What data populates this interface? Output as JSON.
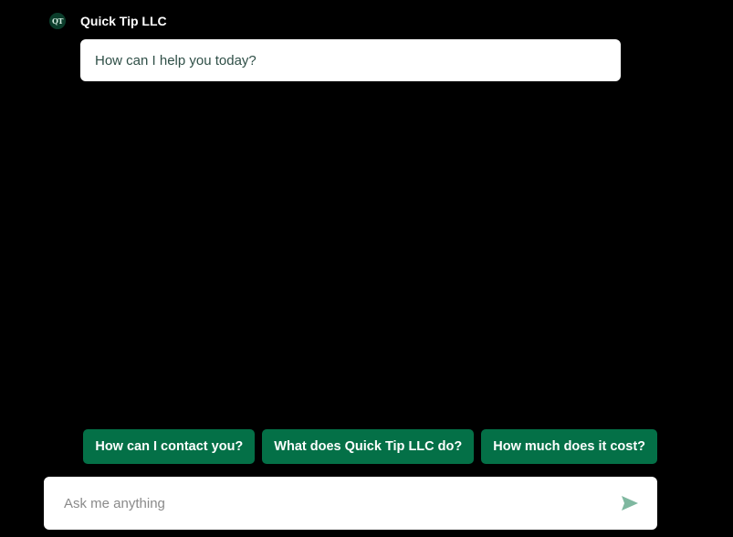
{
  "header": {
    "avatar_text": "QT",
    "bot_name": "Quick Tip LLC"
  },
  "messages": [
    {
      "from": "bot",
      "text": "How can I help you today?"
    }
  ],
  "suggestions": [
    "How can I contact you?",
    "What does Quick Tip LLC do?",
    "How much does it cost?"
  ],
  "input": {
    "placeholder": "Ask me anything",
    "value": ""
  },
  "icons": {
    "avatar": "logo-icon",
    "send": "send-icon"
  },
  "colors": {
    "background": "#000000",
    "accent": "#047047",
    "send_icon": "#7fb8a0",
    "bubble_text": "#2f4f47"
  }
}
